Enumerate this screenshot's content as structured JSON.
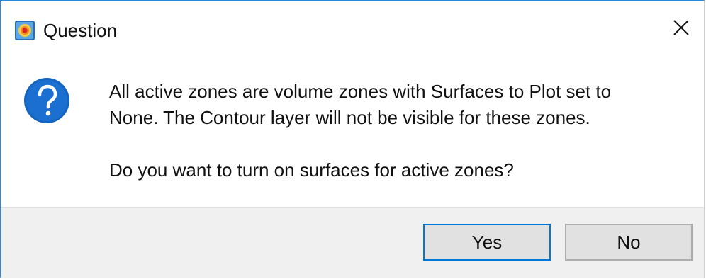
{
  "window": {
    "title": "Question",
    "app_icon": "app-logo-icon",
    "close_icon": "close-icon"
  },
  "message": {
    "icon": "question-icon",
    "line1": "All active zones are volume zones with Surfaces to Plot set to",
    "line2": "None. The Contour layer will not be visible for these zones.",
    "line3": "Do you want to turn on surfaces for active zones?"
  },
  "buttons": {
    "yes_label": "Yes",
    "no_label": "No",
    "default": "Yes"
  },
  "colors": {
    "accent": "#0078d7",
    "question_icon": "#1565c0",
    "footer_bg": "#f0f0f0"
  }
}
